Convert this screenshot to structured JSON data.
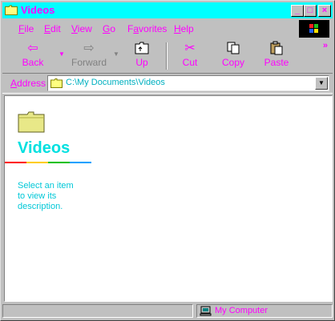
{
  "window": {
    "title": "Videos"
  },
  "titlebar": {
    "minimize": "_",
    "maximize": "□",
    "close": "×"
  },
  "menu": [
    {
      "accel": "F",
      "rest": "ile"
    },
    {
      "accel": "E",
      "rest": "dit"
    },
    {
      "accel": "V",
      "rest": "iew"
    },
    {
      "accel": "G",
      "rest": "o"
    },
    {
      "accel": "F",
      "rest": "a",
      "pre": "",
      "full": "Favorites"
    },
    {
      "accel": "H",
      "rest": "elp"
    }
  ],
  "menu_labels": {
    "file": {
      "accel": "F",
      "rest": "ile"
    },
    "edit": {
      "accel": "E",
      "rest": "dit"
    },
    "view": {
      "accel": "V",
      "rest": "iew"
    },
    "go": {
      "accel": "G",
      "rest": "o"
    },
    "favorites": {
      "pre": "F",
      "accel": "a",
      "rest": "vorites"
    },
    "help": {
      "accel": "H",
      "rest": "elp"
    }
  },
  "toolbar": {
    "back": "Back",
    "forward": "Forward",
    "up": "Up",
    "cut": "Cut",
    "copy": "Copy",
    "paste": "Paste",
    "more": "»"
  },
  "address": {
    "label_accel": "A",
    "label_rest": "ddress",
    "value": "C:\\My Documents\\Videos"
  },
  "content": {
    "title": "Videos",
    "description": "Select an item to view its description."
  },
  "statusbar": {
    "location": "My Computer"
  },
  "colors": {
    "titlebar": "#00ffff",
    "accent": "#ff00ff",
    "content_title": "#00e0e0"
  }
}
